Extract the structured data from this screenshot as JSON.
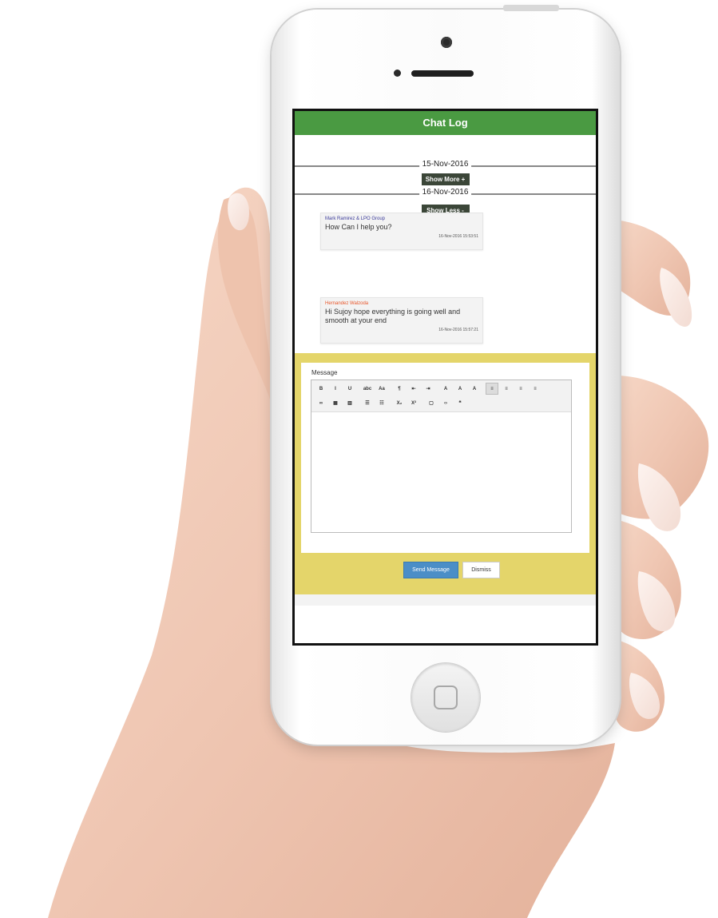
{
  "colors": {
    "header_green": "#4a9a42",
    "compose_yellow": "#e4d56a",
    "sender1_color": "#3b3b9a",
    "sender2_color": "#e8562a",
    "send_blue": "#4b8ec7"
  },
  "header": {
    "title": "Chat Log"
  },
  "dates": [
    {
      "label": "15-Nov-2016",
      "button": "Show More +"
    },
    {
      "label": "16-Nov-2016",
      "button": "Show Less -"
    }
  ],
  "messages": [
    {
      "sender": "Mark Ramirez & LPO Group",
      "text": "How Can I help you?",
      "time": "16-Nov-2016 15:53:51"
    },
    {
      "sender": "Hernandez Walzoda",
      "text": "Hi Sujoy hope everything is going well and smooth at your end",
      "time": "16-Nov-2016 15:57:21"
    }
  ],
  "compose": {
    "label": "Message",
    "toolbar_row1": [
      "B",
      "I",
      "U",
      "abc",
      "Aa",
      "¶",
      "⇤",
      "⇥",
      "A",
      "A",
      "A",
      "≡",
      "≡",
      "≡",
      "≡"
    ],
    "toolbar_row2": [
      "∞",
      "▦",
      "▥",
      "☰",
      "☷",
      "X₂",
      "X²",
      "▢",
      "‹›",
      "❝"
    ],
    "toolbar_icons_row1": [
      "bold-icon",
      "italic-icon",
      "underline-icon",
      "strikethrough-icon",
      "font-size-icon",
      "paragraph-icon",
      "outdent-icon",
      "indent-icon",
      "font-color-icon",
      "highlight-icon",
      "clear-format-icon",
      "align-left-icon",
      "align-center-icon",
      "align-right-icon",
      "justify-icon"
    ],
    "toolbar_icons_row2": [
      "link-icon",
      "table-icon",
      "column-icon",
      "bullet-list-icon",
      "numbered-list-icon",
      "subscript-icon",
      "superscript-icon",
      "image-icon",
      "code-icon",
      "quote-icon"
    ],
    "send_label": "Send Message",
    "dismiss_label": "Dismiss"
  }
}
